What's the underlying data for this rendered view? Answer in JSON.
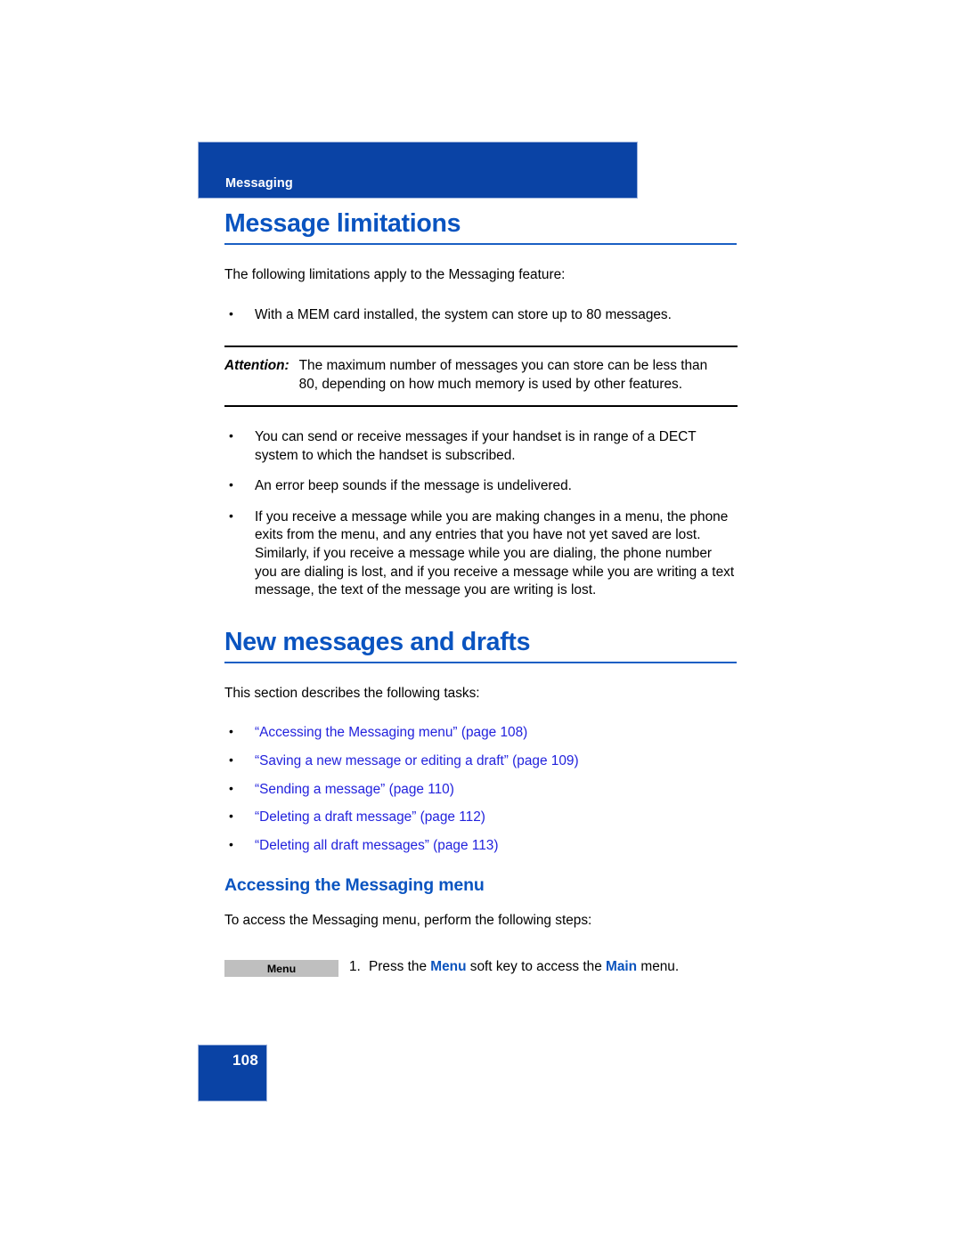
{
  "header": {
    "running_title": "Messaging",
    "band_color": "#0a43a5"
  },
  "sections": [
    {
      "heading": "Message limitations",
      "intro": "The following limitations apply to the Messaging feature:",
      "bullets_before_note": [
        "With a MEM card installed, the system can store up to 80 messages."
      ],
      "note": {
        "label": "Attention:",
        "text": "The maximum number of messages you can store can be less than 80, depending on how much memory is used by other features."
      },
      "bullets_after_note": [
        "You can send or receive messages if your handset is in range of a DECT system to which the handset is subscribed.",
        "An error beep sounds if the message is undelivered.",
        "If you receive a message while you are making changes in a menu, the phone exits from the menu, and any entries that you have not yet saved are lost. Similarly, if you receive a message while you are dialing, the phone number you are dialing is lost, and if you receive a message while you are writing a text message, the text of the message you are writing is lost."
      ]
    },
    {
      "heading": "New messages and drafts",
      "intro": "This section describes the following tasks:",
      "cross_references": [
        "“Accessing the Messaging menu” (page 108)",
        "“Saving a new message or editing a draft” (page 109)",
        "“Sending a message” (page 110)",
        "“Deleting a draft message” (page 112)",
        "“Deleting all draft messages” (page 113)"
      ],
      "subsection": {
        "heading": "Accessing the Messaging menu",
        "intro": "To access the Messaging menu, perform the following steps:",
        "step": {
          "softkey_label": "Menu",
          "number": "1.",
          "text_part1": "Press the ",
          "keyword1": "Menu",
          "text_part2": " soft key to access the ",
          "keyword2": "Main",
          "text_part3": " menu."
        }
      }
    }
  ],
  "footer": {
    "page_number": "108"
  },
  "colors": {
    "heading_blue": "#0a54c0",
    "link_blue": "#2222dd",
    "keyword_blue": "#0b53bd",
    "band_blue": "#0a43a5",
    "softkey_gray": "#bfbfbf"
  }
}
